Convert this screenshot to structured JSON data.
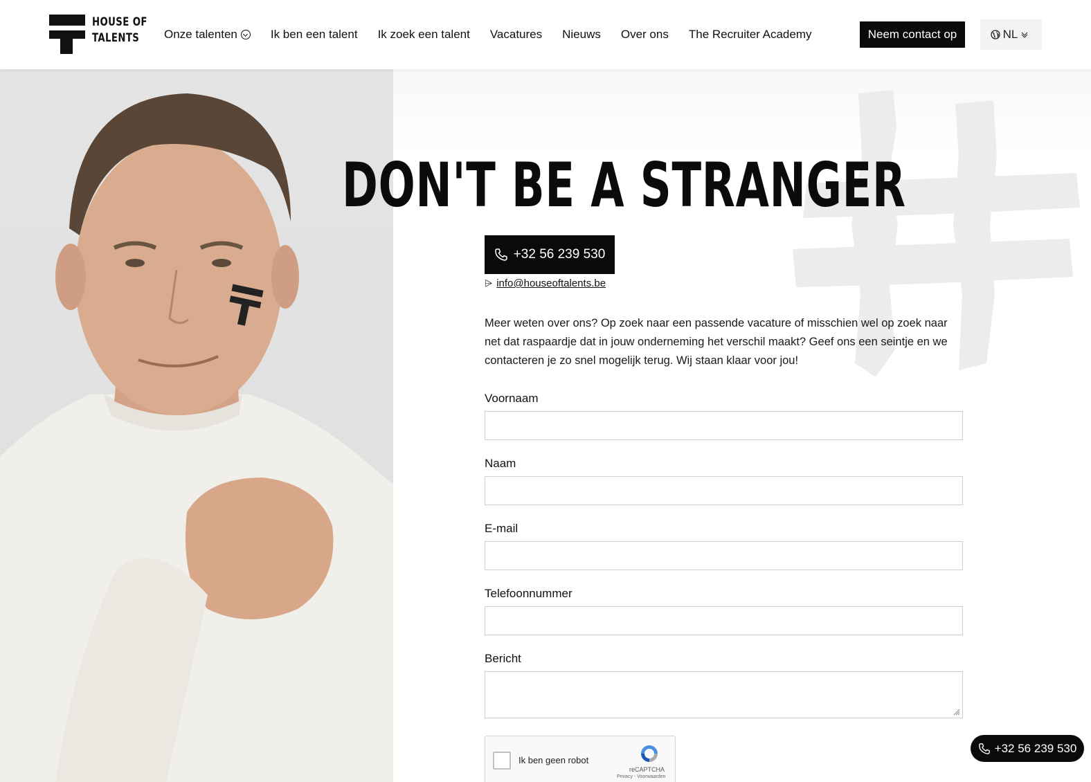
{
  "brand": {
    "logo_line1": "HOUSE OF",
    "logo_line2": "TALENTS"
  },
  "nav": {
    "items": [
      {
        "label": "Onze talenten",
        "has_dropdown": true
      },
      {
        "label": "Ik ben een talent"
      },
      {
        "label": "Ik zoek een talent"
      },
      {
        "label": "Vacatures"
      },
      {
        "label": "Nieuws"
      },
      {
        "label": "Over ons"
      },
      {
        "label": "The Recruiter Academy"
      }
    ],
    "contact_button": "Neem contact op",
    "language": "NL"
  },
  "hero": {
    "headline": "DON'T BE A STRANGER",
    "phone": "+32 56 239 530",
    "email": "info@houseoftalents.be",
    "intro": "Meer weten over ons? Op zoek naar een passende vacature of misschien wel op zoek naar net dat raspaardje dat in jouw onderneming het verschil maakt? Geef ons een seintje en we contacteren je zo snel mogelijk terug. Wij staan klaar voor jou!"
  },
  "form": {
    "first_name_label": "Voornaam",
    "last_name_label": "Naam",
    "email_label": "E-mail",
    "phone_label": "Telefoonnummer",
    "message_label": "Bericht",
    "first_name_value": "",
    "last_name_value": "",
    "email_value": "",
    "phone_value": "",
    "message_value": ""
  },
  "captcha": {
    "label": "Ik ben geen robot",
    "brand": "reCAPTCHA",
    "links": "Privacy - Voorwaarden"
  },
  "floating_phone": "+32 56 239 530",
  "colors": {
    "primary": "#0a0a0a",
    "background": "#ffffff",
    "input_border": "#cfcfcf"
  }
}
